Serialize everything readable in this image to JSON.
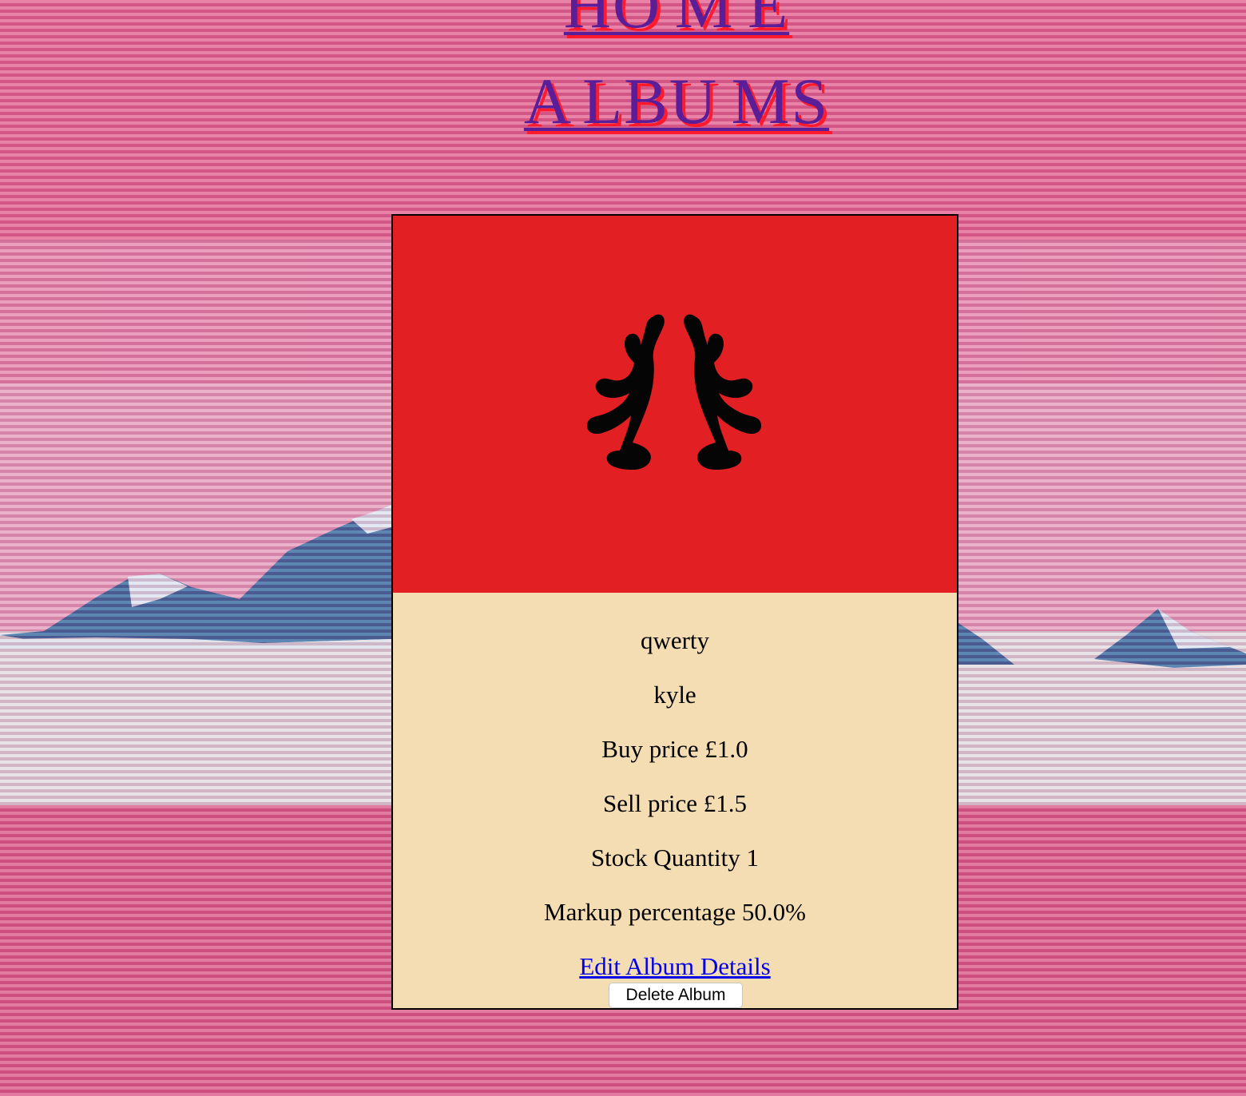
{
  "nav": {
    "home_label": "HO M E",
    "albums_label": "A LBU MS"
  },
  "album": {
    "cover_icon": "antlers-icon",
    "title": "qwerty",
    "artist": "kyle",
    "buy_price": "Buy price £1.0",
    "sell_price": "Sell price £1.5",
    "stock_quantity": "Stock Quantity 1",
    "markup_percentage": "Markup percentage 50.0%",
    "edit_label": "Edit Album Details",
    "delete_label": "Delete Album"
  },
  "colors": {
    "background_pink": "#e0628f",
    "cover_red": "#e21f22",
    "info_bg": "#f5ddb3",
    "nav_text": "#5b1e99",
    "nav_shadow": "#ff1b2d",
    "link_blue": "#0000ee",
    "mountain_blue": "#3f6fa3"
  }
}
